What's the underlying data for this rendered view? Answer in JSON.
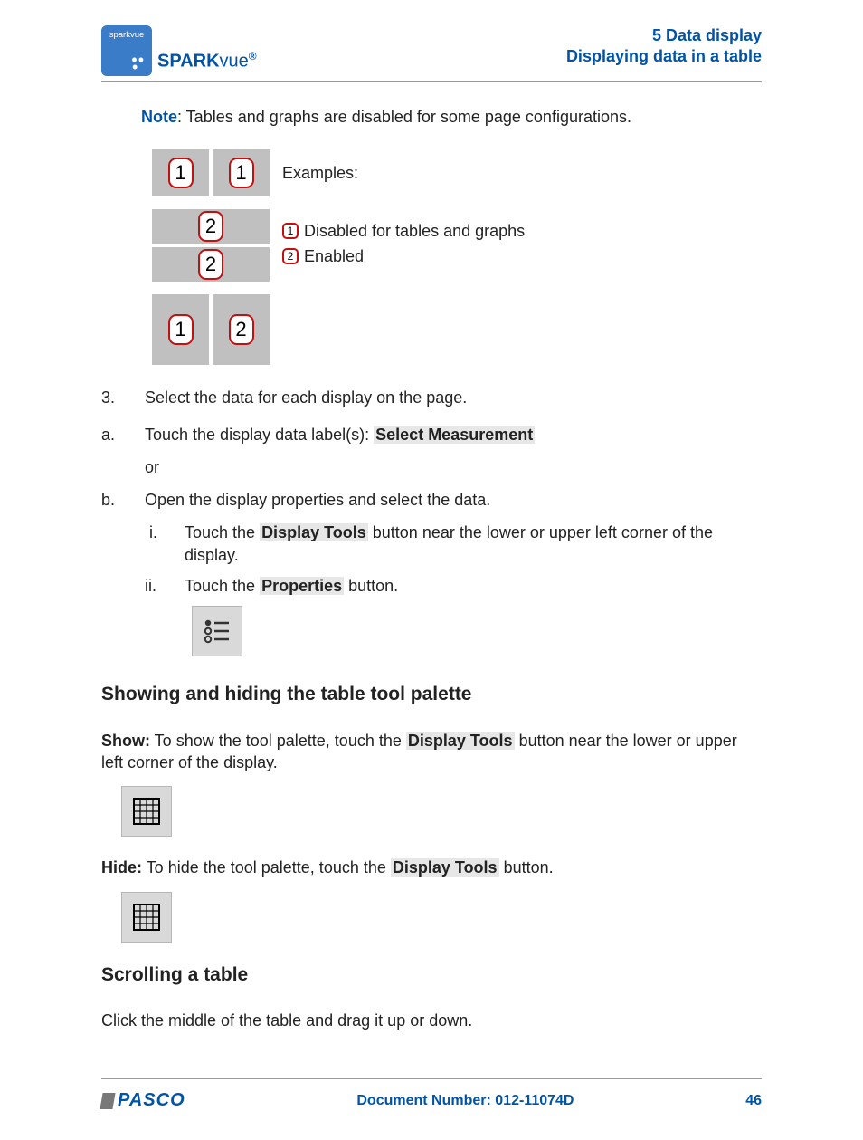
{
  "header": {
    "brand_pre": "SPARK",
    "brand_post": "vue",
    "brand_sup": "®",
    "icon_text": "sparkvue",
    "right_line1": "5   Data display",
    "right_line2": "Displaying data in a table"
  },
  "note": {
    "label": "Note",
    "text": ": Tables and graphs are disabled for some page configurations."
  },
  "examples": {
    "title": "Examples:",
    "legend1": " Disabled for tables and graphs",
    "legend2": " Enabled"
  },
  "steps": {
    "s3": "Select the data for each display on the page.",
    "a_pre": "Touch the display data label(s): ",
    "a_hl": "Select Measurement",
    "or": "or",
    "b": "Open the display properties and select the data.",
    "i_pre": "Touch the ",
    "i_hl": "Display Tools",
    "i_post": " button near the lower or upper left corner of the display.",
    "ii_pre": "Touch the ",
    "ii_hl": "Properties",
    "ii_post": " button."
  },
  "section1": {
    "title": "Showing and hiding the table tool palette",
    "show_bold": "Show:",
    "show_pre": " To show the tool palette, touch the ",
    "show_hl": "Display Tools",
    "show_post": " button near the lower or upper left corner of the display.",
    "hide_bold": "Hide:",
    "hide_pre": " To hide the tool palette, touch the ",
    "hide_hl": "Display Tools",
    "hide_post": " button."
  },
  "section2": {
    "title": "Scrolling a table",
    "text": "Click the middle of the table and drag it up or down."
  },
  "footer": {
    "logo": "PASCO",
    "doc": "Document Number: 012-11074D",
    "page": "46"
  }
}
